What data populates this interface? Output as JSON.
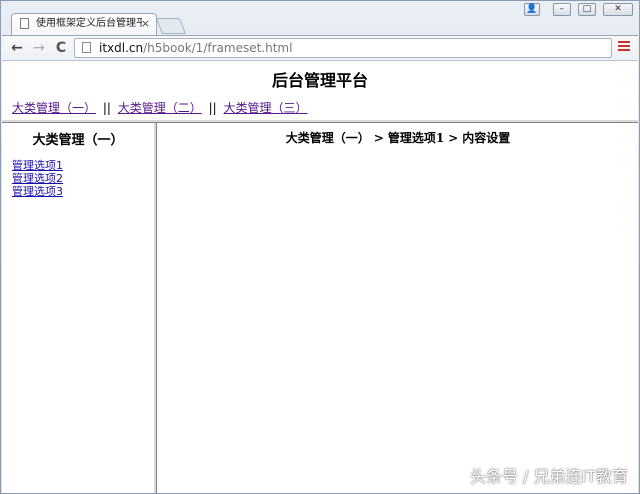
{
  "browser": {
    "tab": {
      "title": "使用框架定义后台管理平台",
      "close_label": "×"
    },
    "window_controls": {
      "user": "👤",
      "minimize": "–",
      "maximize": "□",
      "close": "✕"
    },
    "toolbar": {
      "back": "←",
      "forward": "→",
      "reload": "C",
      "url_host": "itxdl.cn",
      "url_path": "/h5book/1/frameset.html"
    }
  },
  "top_frame": {
    "title": "后台管理平台",
    "nav": [
      {
        "label": "大类管理（一）"
      },
      {
        "label": "大类管理（二）"
      },
      {
        "label": "大类管理（三）"
      }
    ],
    "separator": "||"
  },
  "left_frame": {
    "heading": "大类管理（一）",
    "links": [
      {
        "label": "管理选项1"
      },
      {
        "label": "管理选项2"
      },
      {
        "label": "管理选项3"
      }
    ]
  },
  "main_frame": {
    "breadcrumb": [
      "大类管理（一）",
      "管理选项1",
      "内容设置"
    ],
    "arrow": ">"
  },
  "watermark": "头条号 / 兄弟连IT教育"
}
